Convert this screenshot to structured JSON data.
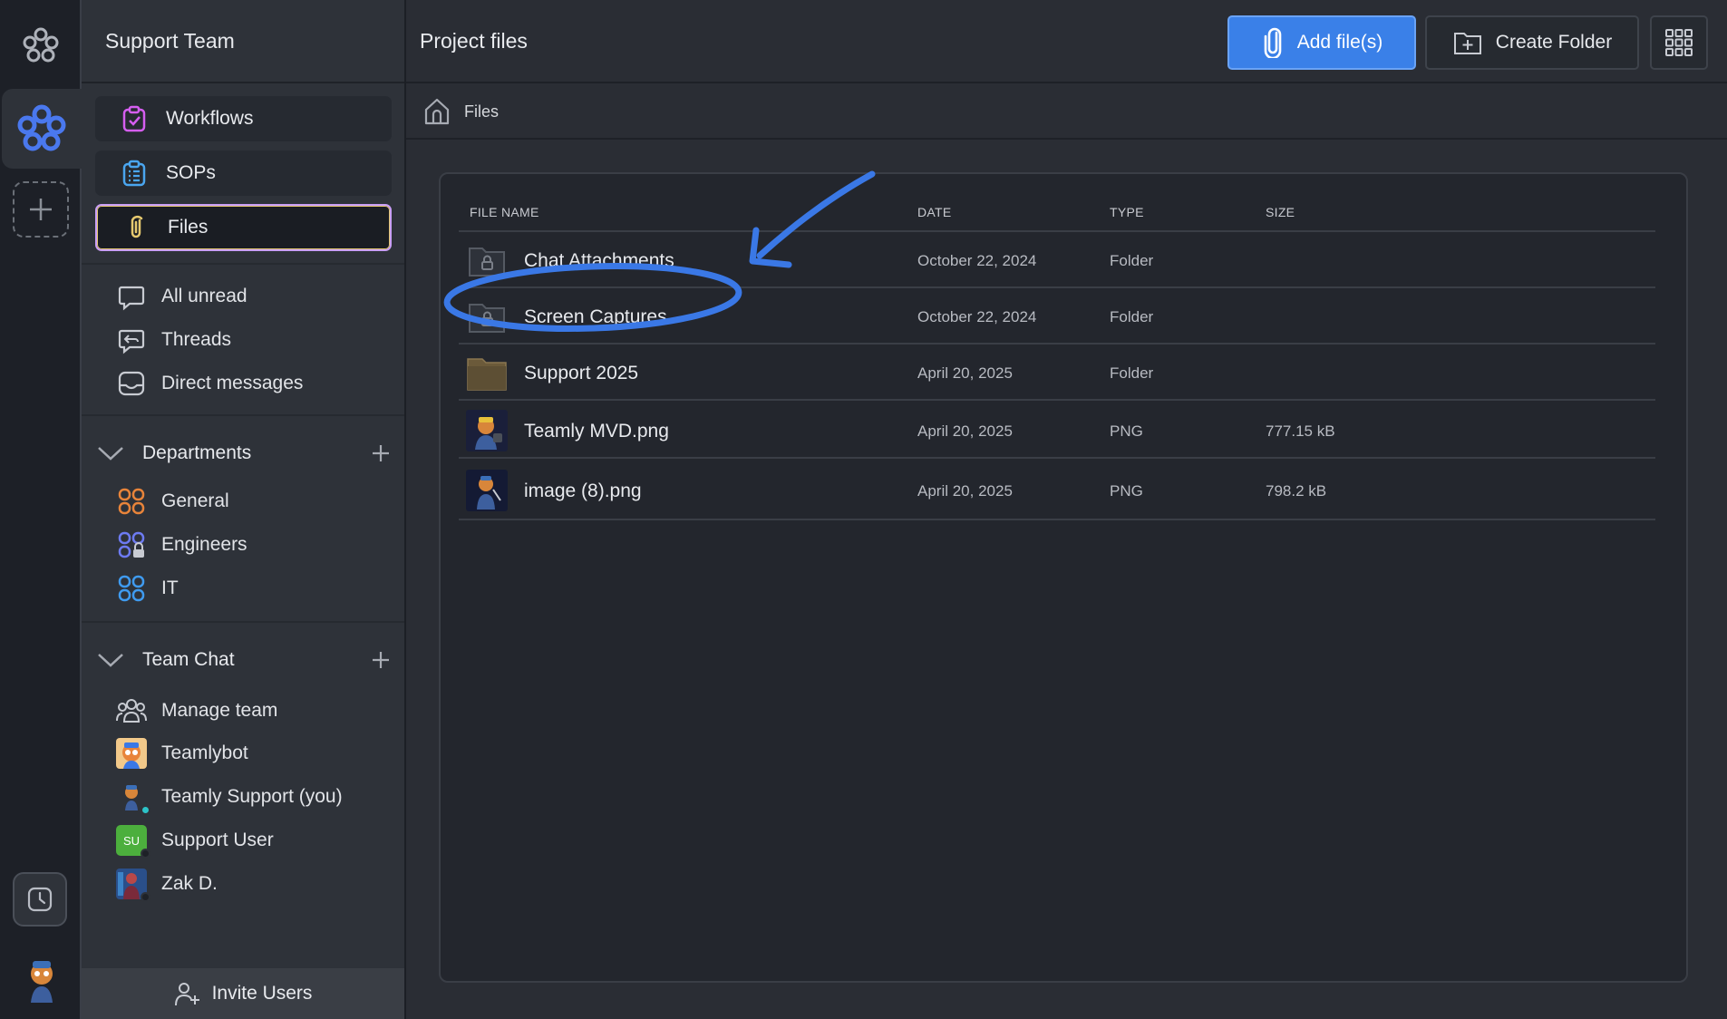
{
  "rail": {
    "logo_icon": "flower-logo-icon",
    "workspace_icon": "workspace-flower-icon",
    "add_workspace_icon": "plus-icon",
    "history_icon": "clock-icon",
    "avatar_icon": "user-avatar"
  },
  "sidebar": {
    "team_name": "Support Team",
    "pills": [
      {
        "label": "Workflows",
        "icon": "workflow-icon"
      },
      {
        "label": "SOPs",
        "icon": "clipboard-list-icon"
      },
      {
        "label": "Files",
        "icon": "paperclip-icon",
        "active": true
      }
    ],
    "nav": [
      {
        "label": "All unread",
        "icon": "chat-bubble-icon"
      },
      {
        "label": "Threads",
        "icon": "threads-icon"
      },
      {
        "label": "Direct messages",
        "icon": "inbox-icon"
      }
    ],
    "departments": {
      "title": "Departments",
      "items": [
        {
          "label": "General",
          "color": "#e8843a"
        },
        {
          "label": "Engineers",
          "color": "#6d7bf2"
        },
        {
          "label": "IT",
          "color": "#3f9bf0"
        }
      ]
    },
    "team_chat": {
      "title": "Team Chat",
      "items": [
        {
          "label": "Manage team",
          "icon": "team-icon"
        },
        {
          "label": "Teamlybot",
          "icon": "bot-avatar"
        },
        {
          "label": "Teamly Support (you)",
          "icon": "support-avatar",
          "presence": "#2cc3c8"
        },
        {
          "label": "Support User",
          "badge": "SU",
          "presence": "#1e2127"
        },
        {
          "label": "Zak D.",
          "icon": "zak-avatar",
          "presence": "#1e2127"
        }
      ]
    },
    "invite_label": "Invite Users"
  },
  "main": {
    "title": "Project files",
    "add_files_label": "Add file(s)",
    "create_folder_label": "Create Folder",
    "breadcrumb": "Files",
    "columns": [
      "FILE NAME",
      "DATE",
      "TYPE",
      "SIZE"
    ],
    "rows": [
      {
        "name": "Chat Attachments",
        "date": "October 22, 2024",
        "type": "Folder",
        "size": "",
        "kind": "locked-folder"
      },
      {
        "name": "Screen Captures",
        "date": "October 22, 2024",
        "type": "Folder",
        "size": "",
        "kind": "locked-folder"
      },
      {
        "name": "Support 2025",
        "date": "April 20, 2025",
        "type": "Folder",
        "size": "",
        "kind": "folder"
      },
      {
        "name": "Teamly MVD.png",
        "date": "April 20, 2025",
        "type": "PNG",
        "size": "777.15 kB",
        "kind": "image"
      },
      {
        "name": "image (8).png",
        "date": "April 20, 2025",
        "type": "PNG",
        "size": "798.2 kB",
        "kind": "image"
      }
    ]
  },
  "colors": {
    "accent_blue": "#3a80e8",
    "annotation_blue": "#3a78e6",
    "active_border": "#c99ff5"
  }
}
